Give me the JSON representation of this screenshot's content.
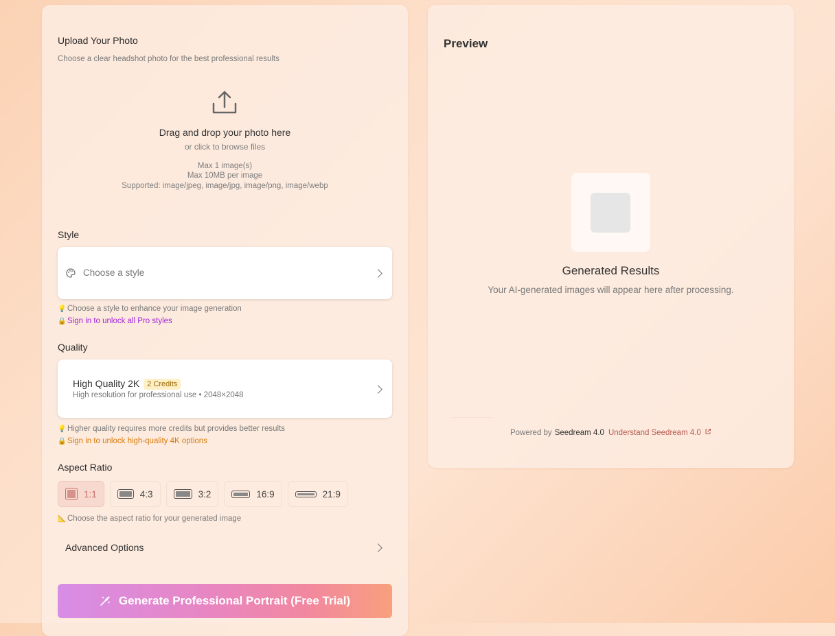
{
  "upload": {
    "title": "Upload Your Photo",
    "subtitle": "Choose a clear headshot photo for the best professional results",
    "drop_title": "Drag and drop your photo here",
    "drop_sub": "or click to browse files",
    "max_images": "Max 1 image(s)",
    "max_size": "Max 10MB per image",
    "supported": "Supported: image/jpeg, image/jpg, image/png, image/webp"
  },
  "style": {
    "label": "Style",
    "placeholder": "Choose a style",
    "hint": "Choose a style to enhance your image generation",
    "unlock": "Sign in to unlock all Pro styles"
  },
  "quality": {
    "label": "Quality",
    "name": "High Quality 2K",
    "badge": "2 Credits",
    "desc": "High resolution for professional use • 2048×2048",
    "hint": "Higher quality requires more credits but provides better results",
    "unlock": "Sign in to unlock high-quality 4K options"
  },
  "aspect": {
    "label": "Aspect Ratio",
    "options": [
      "1:1",
      "4:3",
      "3:2",
      "16:9",
      "21:9"
    ],
    "selected": "1:1",
    "hint": "Choose the aspect ratio for your generated image"
  },
  "advanced": {
    "label": "Advanced Options"
  },
  "generate": {
    "label": "Generate Professional Portrait (Free Trial)"
  },
  "preview": {
    "title": "Preview",
    "results_title": "Generated Results",
    "results_sub": "Your AI-generated images will appear here after processing.",
    "powered_by": "Powered by",
    "model": "Seedream 4.0",
    "learn_link": "Understand Seedream 4.0"
  },
  "colors": {
    "accent_purple": "#a323d8",
    "accent_orange": "#d87a0b",
    "selected_ratio": "#c66a63"
  }
}
